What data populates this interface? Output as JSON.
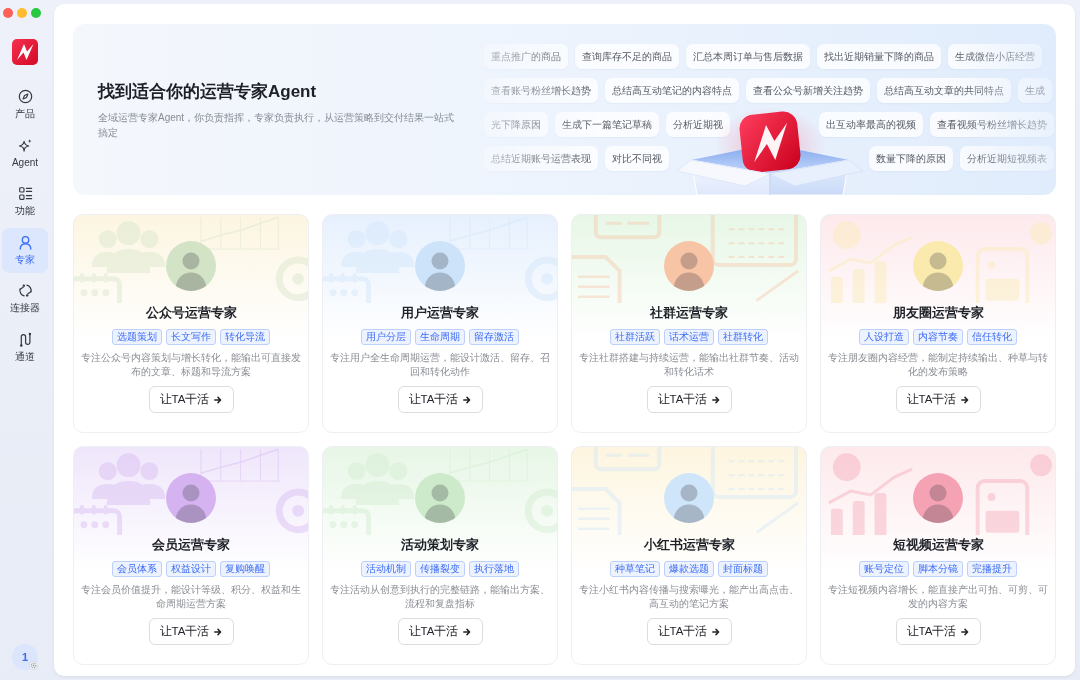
{
  "sidebar": {
    "items": [
      {
        "label": "产品",
        "selected": false
      },
      {
        "label": "Agent",
        "selected": false
      },
      {
        "label": "功能",
        "selected": false
      },
      {
        "label": "专家",
        "selected": true
      },
      {
        "label": "连接器",
        "selected": false
      },
      {
        "label": "通道",
        "selected": false
      }
    ],
    "account": {
      "label": "1"
    }
  },
  "banner": {
    "title": "找到适合你的运营专家Agent",
    "subtitle": "全域运营专家Agent，你负责指挥，专家负责执行，从运营策略到交付结果一站式搞定",
    "prompt_rows": [
      {
        "left": [
          "重点推广的商品",
          "查询库存不足的商品",
          "汇总本周订单与售后数据",
          "找出近期销量下降的商品",
          "生成微信小店经营"
        ]
      },
      {
        "left": [
          "查看账号粉丝增长趋势",
          "总结高互动笔记的内容特点",
          "查看公众号新增关注趋势",
          "总结高互动文章的共同特点",
          "生成"
        ]
      },
      {
        "left": [
          "光下降原因",
          "生成下一篇笔记草稿",
          "分析近期视"
        ],
        "right": [
          "出互动率最高的视频",
          "查看视频号粉丝增长趋势"
        ]
      },
      {
        "left": [
          "总结近期账号运营表现",
          "对比不同视"
        ],
        "right": [
          "数量下降的原因",
          "分析近期短视频表"
        ]
      }
    ]
  },
  "cards": [
    {
      "title": "公众号运营专家",
      "color": "#fcf5e1",
      "avatar": {
        "color": "#d3e3c5"
      },
      "tags": [
        "选题策划",
        "长文写作",
        "转化导流"
      ],
      "description": "专注公众号内容策划与增长转化，能输出可直接发布的文章、标题和导流方案",
      "button": "让TA干活"
    },
    {
      "title": "用户运营专家",
      "color": "#e6f0fd",
      "avatar": {
        "color": "#cce3fa"
      },
      "tags": [
        "用户分层",
        "生命周期",
        "留存激活"
      ],
      "description": "专注用户全生命周期运营，能设计激活、留存、召回和转化动作",
      "button": "让TA干活"
    },
    {
      "title": "社群运营专家",
      "color": "#e7f7e6",
      "avatar": {
        "color": "#f8c4a6"
      },
      "tags": [
        "社群活跃",
        "话术运营",
        "社群转化"
      ],
      "description": "专注社群搭建与持续运营，能输出社群节奏、活动和转化话术",
      "button": "让TA干活"
    },
    {
      "title": "朋友圈运营专家",
      "color": "#fde9ec",
      "avatar": {
        "color": "#faeaae"
      },
      "tags": [
        "人设打造",
        "内容节奏",
        "信任转化"
      ],
      "description": "专注朋友圈内容经营，能制定持续输出、种草与转化的发布策略",
      "button": "让TA干活"
    },
    {
      "title": "会员运营专家",
      "color": "#efe6fb",
      "avatar": {
        "color": "#d5b3f1"
      },
      "tags": [
        "会员体系",
        "权益设计",
        "复购唤醒"
      ],
      "description": "专注会员价值提升，能设计等级、积分、权益和生命周期运营方案",
      "button": "让TA干活"
    },
    {
      "title": "活动策划专家",
      "color": "#e7f6e6",
      "avatar": {
        "color": "#cdebcb"
      },
      "tags": [
        "活动机制",
        "传播裂变",
        "执行落地"
      ],
      "description": "专注活动从创意到执行的完整链路，能输出方案、流程和复盘指标",
      "button": "让TA干活"
    },
    {
      "title": "小红书运营专家",
      "color": "#fdf5df",
      "avatar": {
        "color": "#cfe5fa"
      },
      "tags": [
        "种草笔记",
        "爆款选题",
        "封面标题"
      ],
      "description": "专注小红书内容传播与搜索曝光，能产出高点击、高互动的笔记方案",
      "button": "让TA干活"
    },
    {
      "title": "短视频运营专家",
      "color": "#fde9ec",
      "avatar": {
        "color": "#f5a3b4"
      },
      "tags": [
        "账号定位",
        "脚本分镜",
        "完播提升"
      ],
      "description": "专注短视频内容增长，能直接产出可拍、可剪、可发的内容方案",
      "button": "让TA干活"
    }
  ]
}
